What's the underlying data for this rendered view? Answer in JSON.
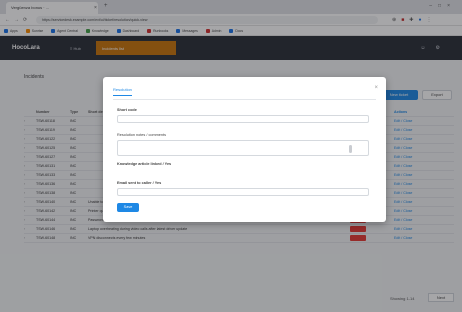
{
  "browser": {
    "tab_title": "Vergüenza bonus · ...",
    "url": "https://servicedesk.example.com/ext/ui/ticket/resolution/quick-view",
    "bookmarks": [
      "Apps",
      "Sunrise",
      "Agent Central",
      "Knowledge",
      "Dashboard",
      "Runbooks",
      "Messages",
      "Admin",
      "Docs"
    ]
  },
  "app": {
    "brand": "HocoLara",
    "menu_label": "Hub",
    "active_menu": "Incidents list",
    "page_title": "Incidents",
    "new_button": "New ticket",
    "export_button": "Export"
  },
  "table": {
    "headers": [
      "Number",
      "Type",
      "Short description",
      "Status",
      "Actions"
    ],
    "rows": [
      {
        "num": "TSW-60118",
        "type": "INC",
        "desc": "",
        "status": "green",
        "actions": "Edit / Close"
      },
      {
        "num": "TSW-60119",
        "type": "INC",
        "desc": "",
        "status": "green",
        "actions": "Edit / Close"
      },
      {
        "num": "TSW-60122",
        "type": "INC",
        "desc": "",
        "status": "green",
        "actions": "Edit / Close"
      },
      {
        "num": "TSW-60125",
        "type": "INC",
        "desc": "",
        "status": "green",
        "actions": "Edit / Close"
      },
      {
        "num": "TSW-60127",
        "type": "INC",
        "desc": "",
        "status": "green",
        "actions": "Edit / Close"
      },
      {
        "num": "TSW-60131",
        "type": "INC",
        "desc": "",
        "status": "green",
        "actions": "Edit / Close"
      },
      {
        "num": "TSW-60133",
        "type": "INC",
        "desc": "",
        "status": "green",
        "actions": "Edit / Close"
      },
      {
        "num": "TSW-60136",
        "type": "INC",
        "desc": "",
        "status": "green",
        "actions": "Edit / Close"
      },
      {
        "num": "TSW-60138",
        "type": "INC",
        "desc": "",
        "status": "green",
        "actions": "Edit / Close"
      },
      {
        "num": "TSW-60140",
        "type": "INC",
        "desc": "Unable to access shared folder from branch office",
        "status": "red",
        "actions": "Edit / Close"
      },
      {
        "num": "TSW-60142",
        "type": "INC",
        "desc": "Printer queue stuck on third floor",
        "status": "red",
        "actions": "Edit / Close"
      },
      {
        "num": "TSW-60144",
        "type": "INC",
        "desc": "Password reset request",
        "status": "red",
        "actions": "Edit / Close"
      },
      {
        "num": "TSW-60146",
        "type": "INC",
        "desc": "Laptop overheating during video calls after latest driver update",
        "status": "red",
        "actions": "Edit / Close"
      },
      {
        "num": "TSW-60148",
        "type": "INC",
        "desc": "VPN disconnects every few minutes",
        "status": "red",
        "actions": "Edit / Close"
      }
    ]
  },
  "pager": {
    "label": "Showing 1-14",
    "next": "Next"
  },
  "modal": {
    "tab": "Resolution",
    "close": "×",
    "field1_label": "Short code",
    "field2_label": "Resolution notes / comments",
    "field3_label": "Knowledge article linked / Yes",
    "field4_label": "Email sent to caller / Yes",
    "submit": "Save"
  },
  "colors": {
    "accent": "#1e88e5",
    "active_menu": "#c9740a",
    "header": "#2b2f38"
  }
}
